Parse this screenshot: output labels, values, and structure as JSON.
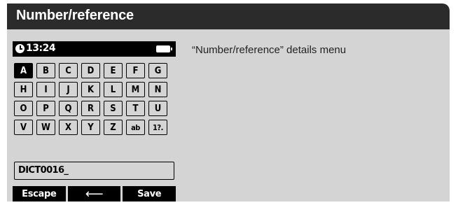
{
  "header": {
    "title": "Number/reference"
  },
  "description": "“Number/reference” details menu",
  "device": {
    "status": {
      "time": "13:24",
      "clock_icon": "clock-icon",
      "battery_icon": "battery-full-icon"
    },
    "keypad": {
      "rows": [
        [
          "A",
          "B",
          "C",
          "D",
          "E",
          "F",
          "G"
        ],
        [
          "H",
          "I",
          "J",
          "K",
          "L",
          "M",
          "N"
        ],
        [
          "O",
          "P",
          "Q",
          "R",
          "S",
          "T",
          "U"
        ],
        [
          "V",
          "W",
          "X",
          "Y",
          "Z",
          "ab",
          "1?."
        ]
      ],
      "selected": "A"
    },
    "entry_value": "DICT0016_",
    "softkeys": {
      "left": "Escape",
      "middle": "⟵",
      "right": "Save"
    }
  },
  "colors": {
    "header_bg": "#2b2b2b",
    "panel_bg": "#d4d4d4",
    "screen_fg": "#000000"
  }
}
